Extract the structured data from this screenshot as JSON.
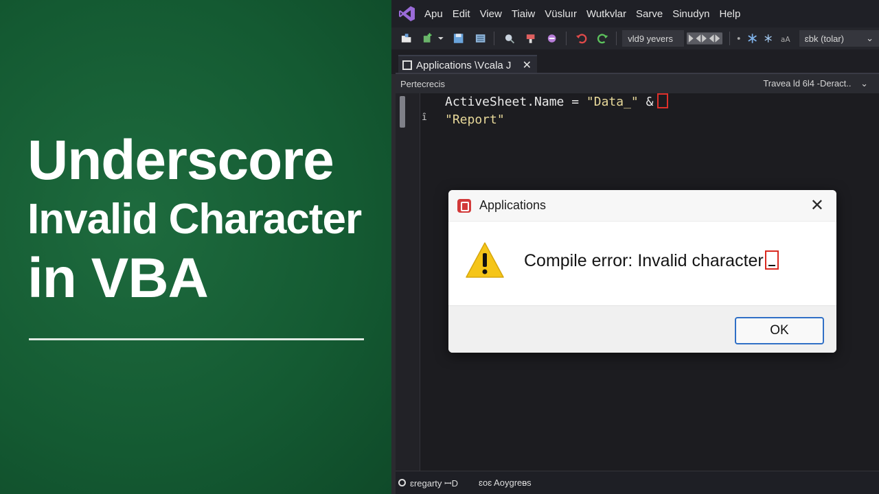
{
  "headline": {
    "line1": "Underscore",
    "line2": "Invalid Character",
    "line3": "in VBA"
  },
  "menubar": {
    "items": [
      "Apu",
      "Edit",
      "View",
      "Tiaiw",
      "Vüsluır",
      "Wutkvlar",
      "Sarve",
      "Sinudyn",
      "Help"
    ]
  },
  "toolbar": {
    "combo1": "vld9 yevers",
    "combo2": "ɛbk (tolar)",
    "combo2_arrow": "⌄"
  },
  "tab": {
    "label": "Applications \\Vcala J",
    "close": "✕"
  },
  "navbar": {
    "left": "Pertecrecis",
    "right": "Travea ld 6l4 -Deract..",
    "right_arrow": "⌄"
  },
  "code": {
    "line1_prefix": "ActiveSheet.Name = ",
    "line1_string": "\"Data_\"",
    "line1_op": " &",
    "line2_string": "\"Report\"",
    "gutter_mark": "ȋ"
  },
  "statusbar": {
    "left": "ɛregarty ꟷD",
    "right": "ɛoɛ Aoygreᴃs"
  },
  "dialog": {
    "title": "Applications",
    "close": "✕",
    "message": "Compile error: Invalid character",
    "ok_label": "OK"
  },
  "colors": {
    "left_bg": "#145a32",
    "ide_bg": "#1f1f24",
    "string_color": "#e8d99a",
    "error_red": "#d9291f",
    "ok_border": "#2f6fc6"
  }
}
